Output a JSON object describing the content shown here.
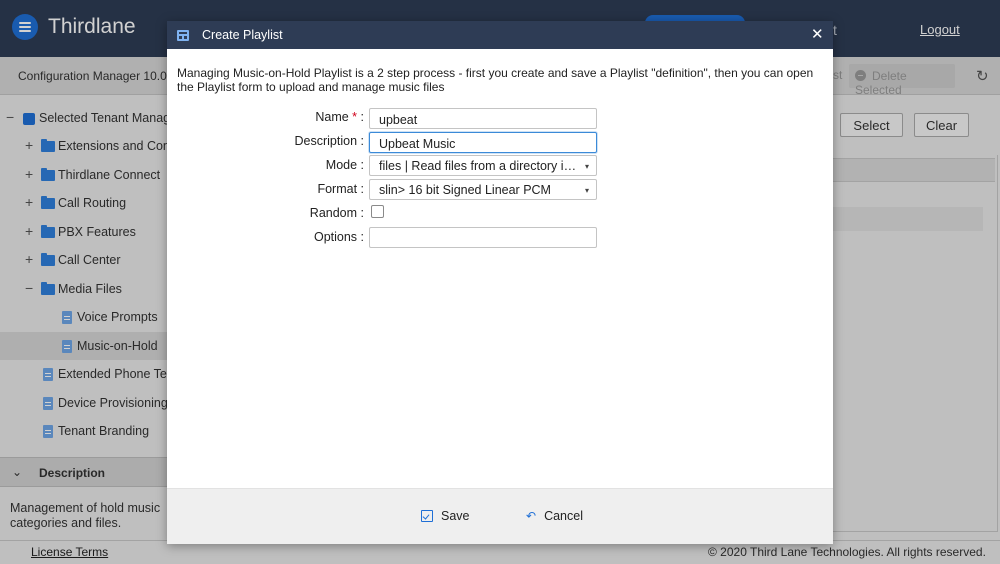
{
  "app": {
    "name": "Thirdlane",
    "top_partial": "t",
    "logout": "Logout",
    "subheader": "Configuration Manager 10.0.1.",
    "toolbar_stub": "st",
    "delete_selected": "Delete Selected",
    "refresh_icon": "refresh-icon"
  },
  "sidebar": {
    "items": [
      {
        "label": "Selected Tenant Manag",
        "toggle": "−",
        "icon": "tenant-icon"
      },
      {
        "label": "Extensions and Cont",
        "toggle": "+",
        "icon": "folder-icon"
      },
      {
        "label": "Thirdlane Connect",
        "toggle": "+",
        "icon": "folder-icon"
      },
      {
        "label": "Call Routing",
        "toggle": "+",
        "icon": "folder-icon"
      },
      {
        "label": "PBX Features",
        "toggle": "+",
        "icon": "folder-icon"
      },
      {
        "label": "Call Center",
        "toggle": "+",
        "icon": "folder-icon"
      },
      {
        "label": "Media Files",
        "toggle": "−",
        "icon": "folder-icon"
      },
      {
        "label": "Voice Prompts",
        "toggle": "",
        "icon": "document-icon"
      },
      {
        "label": "Music-on-Hold",
        "toggle": "",
        "icon": "document-icon",
        "selected": true
      },
      {
        "label": "Extended Phone Ten",
        "toggle": "",
        "icon": "document-icon"
      },
      {
        "label": "Device Provisioning",
        "toggle": "",
        "icon": "document-icon"
      },
      {
        "label": "Tenant Branding",
        "toggle": "",
        "icon": "document-icon"
      }
    ],
    "description_header": "Description",
    "description_text": "Management of hold music categories and files."
  },
  "right": {
    "select_label": "Select",
    "clear_label": "Clear"
  },
  "footer": {
    "license": "License Terms",
    "copyright": "© 2020 Third Lane Technologies. All rights reserved."
  },
  "modal": {
    "title": "Create Playlist",
    "close_glyph": "✕",
    "intro": "Managing Music-on-Hold Playlist is a 2 step process - first you create and save a Playlist \"definition\", then you can open the Playlist form to upload and manage music files",
    "fields": {
      "name_label": "Name",
      "name_required": "*",
      "name_value": "upbeat",
      "description_label": "Description :",
      "description_value": "Upbeat Music",
      "mode_label": "Mode :",
      "mode_value": "files | Read files from a directory in an…",
      "format_label": "Format :",
      "format_value": "slin> 16 bit Signed Linear PCM",
      "random_label": "Random :",
      "random_checked": false,
      "options_label": "Options :",
      "options_value": ""
    },
    "save_label": "Save",
    "cancel_label": "Cancel"
  },
  "colors": {
    "header_bg": "#2e3c55",
    "accent": "#1f6fd6",
    "required": "#d0021b"
  }
}
